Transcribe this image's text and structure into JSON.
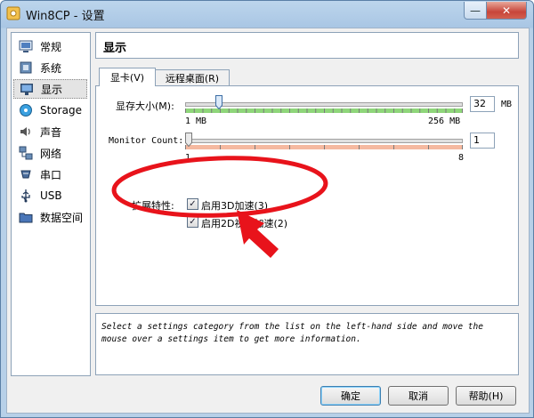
{
  "window": {
    "title": "Win8CP - 设置",
    "minimize_glyph": "—",
    "close_glyph": "✕"
  },
  "sidebar": {
    "items": [
      {
        "label": "常规",
        "icon": "general-icon"
      },
      {
        "label": "系统",
        "icon": "system-icon"
      },
      {
        "label": "显示",
        "icon": "display-icon",
        "selected": true
      },
      {
        "label": "Storage",
        "icon": "storage-icon"
      },
      {
        "label": "声音",
        "icon": "audio-icon"
      },
      {
        "label": "网络",
        "icon": "network-icon"
      },
      {
        "label": "串口",
        "icon": "serial-port-icon"
      },
      {
        "label": "USB",
        "icon": "usb-icon"
      },
      {
        "label": "数据空间",
        "icon": "shared-folders-icon"
      }
    ]
  },
  "header": {
    "title": "显示"
  },
  "tabs": [
    {
      "label": "显卡(V)",
      "active": true
    },
    {
      "label": "远程桌面(R)",
      "active": false
    }
  ],
  "video": {
    "memory_label": "显存大小(M):",
    "memory_value": "32",
    "memory_unit": "MB",
    "memory_min": "1 MB",
    "memory_max": "256 MB",
    "memory_fraction": 0.121,
    "monitor_label": "Monitor Count:",
    "monitor_value": "1",
    "monitor_min": "1",
    "monitor_max": "8",
    "monitor_fraction": 0.0,
    "ext_label": "扩展特性:",
    "accel3d_label": "启用3D加速(3)",
    "accel3d_checked": true,
    "accel2d_label": "启用2D视频加速(2)",
    "accel2d_checked": true
  },
  "info": {
    "text": "Select a settings category from the list on the left-hand side and move the mouse over a settings item to get more information."
  },
  "buttons": {
    "ok": "确定",
    "cancel": "取消",
    "help": "帮助(H)"
  },
  "colors": {
    "accent_red": "#e8131b",
    "slider_good": "#8fd67a",
    "slider_bad": "#f5b9a0"
  }
}
